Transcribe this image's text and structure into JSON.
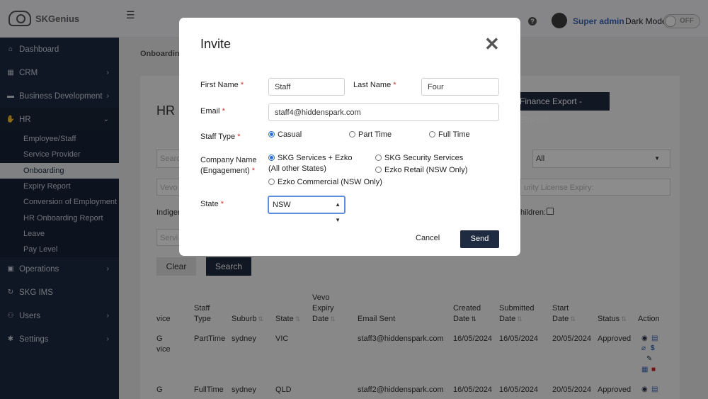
{
  "app": {
    "name": "SKGenius"
  },
  "header": {
    "help_icon": "?",
    "user_name": "Super admin",
    "dark_mode_label": "Dark Mode",
    "dark_mode_state": "OFF"
  },
  "sidebar": {
    "items": [
      {
        "label": "Dashboard",
        "icon": "home-icon"
      },
      {
        "label": "CRM",
        "icon": "building-icon"
      },
      {
        "label": "Business Development",
        "icon": "folder-icon"
      },
      {
        "label": "HR",
        "icon": "handshake-icon"
      },
      {
        "label": "Operations",
        "icon": "briefcase-icon"
      },
      {
        "label": "SKG IMS",
        "icon": "refresh-icon"
      },
      {
        "label": "Users",
        "icon": "users-icon"
      },
      {
        "label": "Settings",
        "icon": "gear-icon"
      }
    ],
    "hr_sub": [
      "Employee/Staff",
      "Service Provider",
      "Onboarding",
      "Expiry Report",
      "Conversion of Employment",
      "HR Onboarding Report",
      "Leave",
      "Pay Level"
    ]
  },
  "background": {
    "breadcrumb": "Onboarding",
    "card_title": "HR",
    "finance_export": "Finance Export - ElmSoft",
    "search_placeholder": "Search",
    "select_value": "All",
    "vevo_placeholder": "Vevo",
    "security_license_placeholder": "urity License Expiry:",
    "indigenous_label": "Indiger",
    "children_label": "hildren:",
    "service_placeholder": "Servi",
    "clear_label": "Clear",
    "search_label": "Search",
    "columns": {
      "service": "vice",
      "staff_type": [
        "Staff",
        "Type"
      ],
      "suburb": "Suburb",
      "state": "State",
      "vevo": [
        "Vevo",
        "Expiry",
        "Date"
      ],
      "email_sent": "Email Sent",
      "created": [
        "Created",
        "Date"
      ],
      "submitted": [
        "Submitted",
        "Date"
      ],
      "start": [
        "Start",
        "Date"
      ],
      "status": "Status",
      "action": "Action"
    },
    "rows": [
      {
        "service": [
          "G",
          "vice"
        ],
        "staff_type": "PartTime",
        "suburb": "sydney",
        "state": "VIC",
        "email": "staff3@hiddenspark.com",
        "created": "16/05/2024",
        "submitted": "16/05/2024",
        "start": "20/05/2024",
        "status": "Approved"
      },
      {
        "service": [
          "G",
          ""
        ],
        "staff_type": "FullTime",
        "suburb": "sydney",
        "state": "QLD",
        "email": "staff2@hiddenspark.com",
        "created": "16/05/2024",
        "submitted": "16/05/2024",
        "start": "20/05/2024",
        "status": "Approved"
      }
    ]
  },
  "modal": {
    "title": "Invite",
    "first_name_label": "First Name",
    "first_name_value": "Staff",
    "last_name_label": "Last Name",
    "last_name_value": "Four",
    "email_label": "Email",
    "email_value": "staff4@hiddenspark.com",
    "staff_type_label": "Staff Type",
    "staff_types": [
      "Casual",
      "Part Time",
      "Full Time"
    ],
    "company_label_1": "Company Name",
    "company_label_2": "(Engagement)",
    "companies": [
      [
        "SKG Services + Ezko",
        "(All other States)"
      ],
      [
        "SKG Security Services"
      ],
      [
        "Ezko Retail (NSW Only)"
      ],
      [
        "Ezko Commercial (NSW Only)"
      ]
    ],
    "state_label": "State",
    "state_value": "NSW",
    "cancel_label": "Cancel",
    "send_label": "Send",
    "required_mark": "*"
  }
}
